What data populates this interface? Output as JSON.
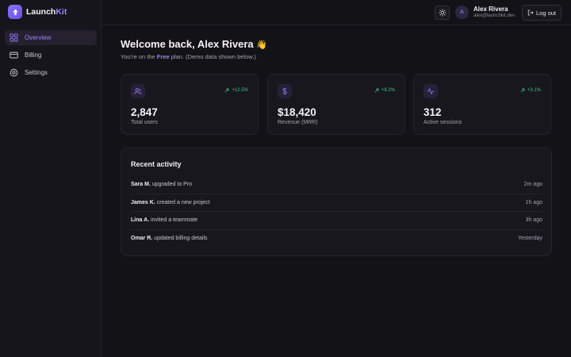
{
  "brand": {
    "name_part1": "Launch",
    "name_part2": "Kit"
  },
  "sidebar": {
    "items": [
      {
        "label": "Overview",
        "icon": "grid-icon",
        "active": true
      },
      {
        "label": "Billing",
        "icon": "credit-card-icon",
        "active": false
      },
      {
        "label": "Settings",
        "icon": "gear-icon",
        "active": false
      }
    ]
  },
  "header": {
    "theme_icon": "sun-icon",
    "avatar_initial": "A",
    "user_name": "Alex Rivera",
    "user_email": "alex@launchkit.dev",
    "logout_label": "Log out"
  },
  "welcome": {
    "title": "Welcome back, Alex Rivera",
    "emoji": "👋",
    "sub_prefix": "You're on the ",
    "plan": "Free",
    "sub_suffix": " plan. (Demo data shown below.)"
  },
  "stats": [
    {
      "icon": "users-icon",
      "change": "+12.5%",
      "value": "2,847",
      "label": "Total users"
    },
    {
      "icon": "dollar-icon",
      "change": "+8.2%",
      "value": "$18,420",
      "label": "Revenue (MRR)"
    },
    {
      "icon": "activity-icon",
      "change": "+3.1%",
      "value": "312",
      "label": "Active sessions"
    }
  ],
  "activity": {
    "title": "Recent activity",
    "items": [
      {
        "who": "Sara M.",
        "action": " upgraded to Pro",
        "time": "2m ago"
      },
      {
        "who": "James K.",
        "action": " created a new project",
        "time": "1h ago"
      },
      {
        "who": "Lina A.",
        "action": " invited a teammate",
        "time": "3h ago"
      },
      {
        "who": "Omar R.",
        "action": " updated billing details",
        "time": "Yesterday"
      }
    ]
  },
  "colors": {
    "accent": "#9b85ff",
    "positive": "#3ec78a",
    "background": "#131217",
    "card": "#18171d"
  }
}
